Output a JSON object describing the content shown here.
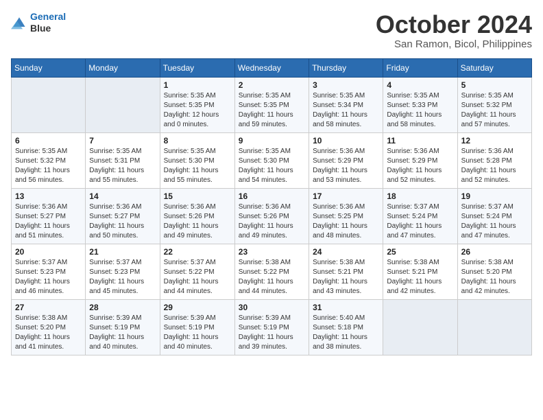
{
  "header": {
    "logo_line1": "General",
    "logo_line2": "Blue",
    "month": "October 2024",
    "location": "San Ramon, Bicol, Philippines"
  },
  "days_of_week": [
    "Sunday",
    "Monday",
    "Tuesday",
    "Wednesday",
    "Thursday",
    "Friday",
    "Saturday"
  ],
  "weeks": [
    [
      {
        "day": "",
        "info": ""
      },
      {
        "day": "",
        "info": ""
      },
      {
        "day": "1",
        "info": "Sunrise: 5:35 AM\nSunset: 5:35 PM\nDaylight: 12 hours\nand 0 minutes."
      },
      {
        "day": "2",
        "info": "Sunrise: 5:35 AM\nSunset: 5:35 PM\nDaylight: 11 hours\nand 59 minutes."
      },
      {
        "day": "3",
        "info": "Sunrise: 5:35 AM\nSunset: 5:34 PM\nDaylight: 11 hours\nand 58 minutes."
      },
      {
        "day": "4",
        "info": "Sunrise: 5:35 AM\nSunset: 5:33 PM\nDaylight: 11 hours\nand 58 minutes."
      },
      {
        "day": "5",
        "info": "Sunrise: 5:35 AM\nSunset: 5:32 PM\nDaylight: 11 hours\nand 57 minutes."
      }
    ],
    [
      {
        "day": "6",
        "info": "Sunrise: 5:35 AM\nSunset: 5:32 PM\nDaylight: 11 hours\nand 56 minutes."
      },
      {
        "day": "7",
        "info": "Sunrise: 5:35 AM\nSunset: 5:31 PM\nDaylight: 11 hours\nand 55 minutes."
      },
      {
        "day": "8",
        "info": "Sunrise: 5:35 AM\nSunset: 5:30 PM\nDaylight: 11 hours\nand 55 minutes."
      },
      {
        "day": "9",
        "info": "Sunrise: 5:35 AM\nSunset: 5:30 PM\nDaylight: 11 hours\nand 54 minutes."
      },
      {
        "day": "10",
        "info": "Sunrise: 5:36 AM\nSunset: 5:29 PM\nDaylight: 11 hours\nand 53 minutes."
      },
      {
        "day": "11",
        "info": "Sunrise: 5:36 AM\nSunset: 5:29 PM\nDaylight: 11 hours\nand 52 minutes."
      },
      {
        "day": "12",
        "info": "Sunrise: 5:36 AM\nSunset: 5:28 PM\nDaylight: 11 hours\nand 52 minutes."
      }
    ],
    [
      {
        "day": "13",
        "info": "Sunrise: 5:36 AM\nSunset: 5:27 PM\nDaylight: 11 hours\nand 51 minutes."
      },
      {
        "day": "14",
        "info": "Sunrise: 5:36 AM\nSunset: 5:27 PM\nDaylight: 11 hours\nand 50 minutes."
      },
      {
        "day": "15",
        "info": "Sunrise: 5:36 AM\nSunset: 5:26 PM\nDaylight: 11 hours\nand 49 minutes."
      },
      {
        "day": "16",
        "info": "Sunrise: 5:36 AM\nSunset: 5:26 PM\nDaylight: 11 hours\nand 49 minutes."
      },
      {
        "day": "17",
        "info": "Sunrise: 5:36 AM\nSunset: 5:25 PM\nDaylight: 11 hours\nand 48 minutes."
      },
      {
        "day": "18",
        "info": "Sunrise: 5:37 AM\nSunset: 5:24 PM\nDaylight: 11 hours\nand 47 minutes."
      },
      {
        "day": "19",
        "info": "Sunrise: 5:37 AM\nSunset: 5:24 PM\nDaylight: 11 hours\nand 47 minutes."
      }
    ],
    [
      {
        "day": "20",
        "info": "Sunrise: 5:37 AM\nSunset: 5:23 PM\nDaylight: 11 hours\nand 46 minutes."
      },
      {
        "day": "21",
        "info": "Sunrise: 5:37 AM\nSunset: 5:23 PM\nDaylight: 11 hours\nand 45 minutes."
      },
      {
        "day": "22",
        "info": "Sunrise: 5:37 AM\nSunset: 5:22 PM\nDaylight: 11 hours\nand 44 minutes."
      },
      {
        "day": "23",
        "info": "Sunrise: 5:38 AM\nSunset: 5:22 PM\nDaylight: 11 hours\nand 44 minutes."
      },
      {
        "day": "24",
        "info": "Sunrise: 5:38 AM\nSunset: 5:21 PM\nDaylight: 11 hours\nand 43 minutes."
      },
      {
        "day": "25",
        "info": "Sunrise: 5:38 AM\nSunset: 5:21 PM\nDaylight: 11 hours\nand 42 minutes."
      },
      {
        "day": "26",
        "info": "Sunrise: 5:38 AM\nSunset: 5:20 PM\nDaylight: 11 hours\nand 42 minutes."
      }
    ],
    [
      {
        "day": "27",
        "info": "Sunrise: 5:38 AM\nSunset: 5:20 PM\nDaylight: 11 hours\nand 41 minutes."
      },
      {
        "day": "28",
        "info": "Sunrise: 5:39 AM\nSunset: 5:19 PM\nDaylight: 11 hours\nand 40 minutes."
      },
      {
        "day": "29",
        "info": "Sunrise: 5:39 AM\nSunset: 5:19 PM\nDaylight: 11 hours\nand 40 minutes."
      },
      {
        "day": "30",
        "info": "Sunrise: 5:39 AM\nSunset: 5:19 PM\nDaylight: 11 hours\nand 39 minutes."
      },
      {
        "day": "31",
        "info": "Sunrise: 5:40 AM\nSunset: 5:18 PM\nDaylight: 11 hours\nand 38 minutes."
      },
      {
        "day": "",
        "info": ""
      },
      {
        "day": "",
        "info": ""
      }
    ]
  ]
}
